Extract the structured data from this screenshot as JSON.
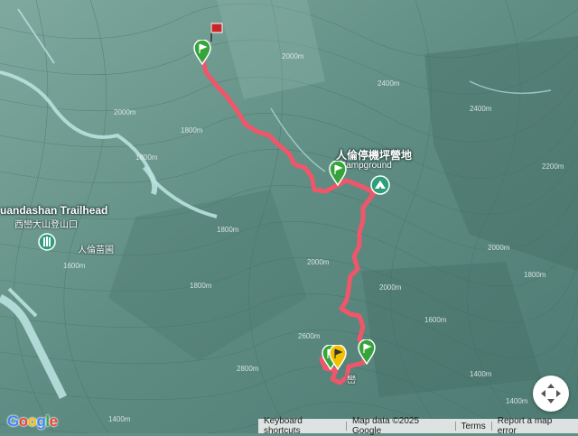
{
  "map": {
    "labels": {
      "campground_zh": "人倫停機坪營地",
      "campground_en": "Campground",
      "trailhead_en": "uandashan Trailhead",
      "trailhead_zh": "西巒大山登山口",
      "nursery_zh": "人倫苗圃",
      "peak_partial": "巒"
    },
    "contours": [
      "2400m",
      "2000m",
      "1800m",
      "1600m",
      "1400m",
      "1800m",
      "2000m",
      "2400m",
      "2000m",
      "1800m",
      "1600m",
      "1400m",
      "2600m",
      "2800m",
      "2000m",
      "1800m",
      "2000m",
      "2200m",
      "1800m",
      "1400m"
    ],
    "colors": {
      "track": "#f0566a",
      "pin_green": "#37a43b",
      "pin_red": "#c62828",
      "pin_yellow": "#f2c200",
      "terrain": "#5f8f86",
      "river": "#b9e1de"
    }
  },
  "controls": {
    "navigation_icon": "move-arrows-icon"
  },
  "attribution": {
    "logo": "Google",
    "keyboard": "Keyboard shortcuts",
    "map_data": "Map data ©2025 Google",
    "terms": "Terms",
    "report": "Report a map error"
  }
}
